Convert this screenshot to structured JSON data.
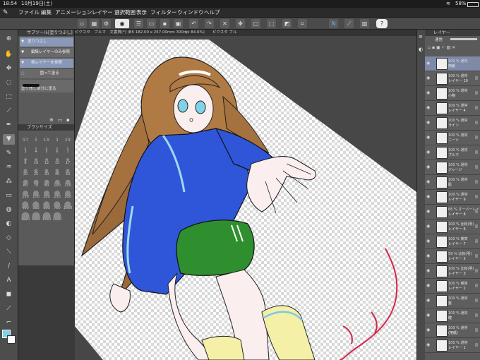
{
  "status": {
    "time": "18:54",
    "date": "10月19日(土)",
    "battery": "58%"
  },
  "menu": {
    "items": [
      "ファイル",
      "編集",
      "アニメーション",
      "レイヤー",
      "選択範囲",
      "表示",
      "フィルター",
      "ウィンドウ",
      "ヘルプ"
    ]
  },
  "subtool": {
    "header": "サブツール[塗りつぶし]",
    "items": [
      "塗りつぶし",
      "編集レイヤーのみ参照",
      "他レイヤーを参照",
      "囲って塗る",
      "塗り残し部分に塗る"
    ]
  },
  "brushsize": {
    "header": "ブラシサイズ",
    "sizes": [
      "0.7",
      "1",
      "1.5",
      "2",
      "2.5",
      "3",
      "4",
      "5",
      "6",
      "7",
      "8",
      "10",
      "12",
      "15",
      "17",
      "20",
      "25",
      "30",
      "40",
      "50",
      "60",
      "70",
      "80",
      "100",
      "120",
      "150",
      "170",
      "200",
      "250",
      "300",
      "400",
      "500",
      "600",
      "700",
      "1000",
      "1200",
      "1500",
      "1700",
      "2000"
    ]
  },
  "canvas": {
    "tab": "ピクスタ　ブルマ　文書質(*) (B5 182.00 x 257.00mm 300dpi 84.6%)　　ピクスタ ブル"
  },
  "layers": {
    "header": "レイヤー",
    "blend": "通常",
    "items": [
      {
        "opacity": "100 % 通常",
        "name": "用紙"
      },
      {
        "opacity": "100 % 通常",
        "name": "レイヤー 10"
      },
      {
        "opacity": "100 % 通常",
        "name": "小物"
      },
      {
        "opacity": "100 % 通常",
        "name": "レイヤー 4"
      },
      {
        "opacity": "100 % 通常",
        "name": "ライン"
      },
      {
        "opacity": "100 % 通常",
        "name": "ニーソ"
      },
      {
        "opacity": "100 % 通常",
        "name": "ブルマ"
      },
      {
        "opacity": "100 % 通常",
        "name": "ジャージ"
      },
      {
        "opacity": "100 % 通常",
        "name": "肌"
      },
      {
        "opacity": "100 % 通常",
        "name": "レイヤー 9"
      },
      {
        "opacity": "66 % オーバーレイ",
        "name": "レイヤー 8"
      },
      {
        "opacity": "100 % 比較(明)",
        "name": "レイヤー 6"
      },
      {
        "opacity": "100 % 乗算",
        "name": "レイヤー 7"
      },
      {
        "opacity": "59 % 比較(明)",
        "name": "レイヤー 5"
      },
      {
        "opacity": "100 % 比較(明)",
        "name": "レイヤー 3"
      },
      {
        "opacity": "100 % 乗算",
        "name": "レイヤー 2"
      },
      {
        "opacity": "100 % 通常",
        "name": "髪"
      },
      {
        "opacity": "100 % 通常",
        "name": "瞳"
      },
      {
        "opacity": "100 % 通常",
        "name": "(用紙)"
      },
      {
        "opacity": "100 % 通常",
        "name": "レイヤー 1"
      }
    ]
  },
  "colors": {
    "main": "#7fd3e6",
    "sub": "#ffffff"
  }
}
